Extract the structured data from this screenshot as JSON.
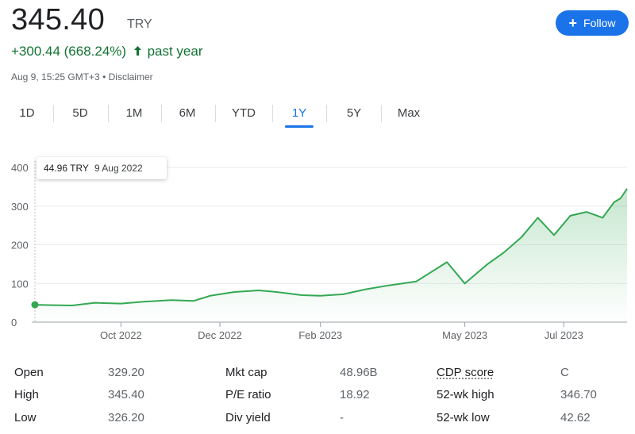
{
  "quote": {
    "price": "345.40",
    "currency": "TRY",
    "change": "+300.44 (668.24%)",
    "period": "past year",
    "timestamp": "Aug 9, 15:25 GMT+3",
    "separator": "•",
    "disclaimer": "Disclaimer",
    "follow_label": "Follow",
    "colors": {
      "up": "#137333",
      "accent": "#1a73e8",
      "line": "#34a853"
    }
  },
  "range_tabs": [
    {
      "label": "1D",
      "active": false
    },
    {
      "label": "5D",
      "active": false
    },
    {
      "label": "1M",
      "active": false
    },
    {
      "label": "6M",
      "active": false
    },
    {
      "label": "YTD",
      "active": false
    },
    {
      "label": "1Y",
      "active": true
    },
    {
      "label": "5Y",
      "active": false
    },
    {
      "label": "Max",
      "active": false
    }
  ],
  "tooltip": {
    "value": "44.96 TRY",
    "date": "9 Aug 2022"
  },
  "chart_data": {
    "type": "area",
    "x_start": "2022-08-09",
    "x_end": "2023-08-09",
    "x_tick_labels": [
      "Oct 2022",
      "Dec 2022",
      "Feb 2023",
      "May 2023",
      "Jul 2023"
    ],
    "y_tick_labels": [
      "0",
      "100",
      "200",
      "300",
      "400"
    ],
    "ylim": [
      0,
      400
    ],
    "grid": true,
    "series": [
      {
        "points": [
          [
            "2022-08-09",
            45
          ],
          [
            "2022-08-20",
            44
          ],
          [
            "2022-09-01",
            43
          ],
          [
            "2022-09-15",
            50
          ],
          [
            "2022-10-01",
            48
          ],
          [
            "2022-10-15",
            53
          ],
          [
            "2022-11-01",
            57
          ],
          [
            "2022-11-15",
            55
          ],
          [
            "2022-11-25",
            68
          ],
          [
            "2022-12-10",
            78
          ],
          [
            "2022-12-25",
            82
          ],
          [
            "2023-01-05",
            78
          ],
          [
            "2023-01-20",
            70
          ],
          [
            "2023-02-01",
            68
          ],
          [
            "2023-02-15",
            72
          ],
          [
            "2023-03-01",
            85
          ],
          [
            "2023-03-15",
            95
          ],
          [
            "2023-04-01",
            105
          ],
          [
            "2023-04-20",
            155
          ],
          [
            "2023-05-01",
            100
          ],
          [
            "2023-05-15",
            150
          ],
          [
            "2023-05-25",
            180
          ],
          [
            "2023-06-05",
            220
          ],
          [
            "2023-06-15",
            270
          ],
          [
            "2023-06-25",
            225
          ],
          [
            "2023-07-05",
            275
          ],
          [
            "2023-07-15",
            285
          ],
          [
            "2023-07-25",
            270
          ],
          [
            "2023-08-01",
            310
          ],
          [
            "2023-08-05",
            320
          ],
          [
            "2023-08-09",
            345
          ]
        ]
      }
    ]
  },
  "stats": [
    {
      "label": "Open",
      "value": "329.20"
    },
    {
      "label": "High",
      "value": "345.40"
    },
    {
      "label": "Low",
      "value": "326.20"
    },
    {
      "label": "Mkt cap",
      "value": "48.96B"
    },
    {
      "label": "P/E ratio",
      "value": "18.92"
    },
    {
      "label": "Div yield",
      "value": "-"
    },
    {
      "label": "CDP score",
      "value": "C"
    },
    {
      "label": "52-wk high",
      "value": "346.70"
    },
    {
      "label": "52-wk low",
      "value": "42.62"
    }
  ]
}
